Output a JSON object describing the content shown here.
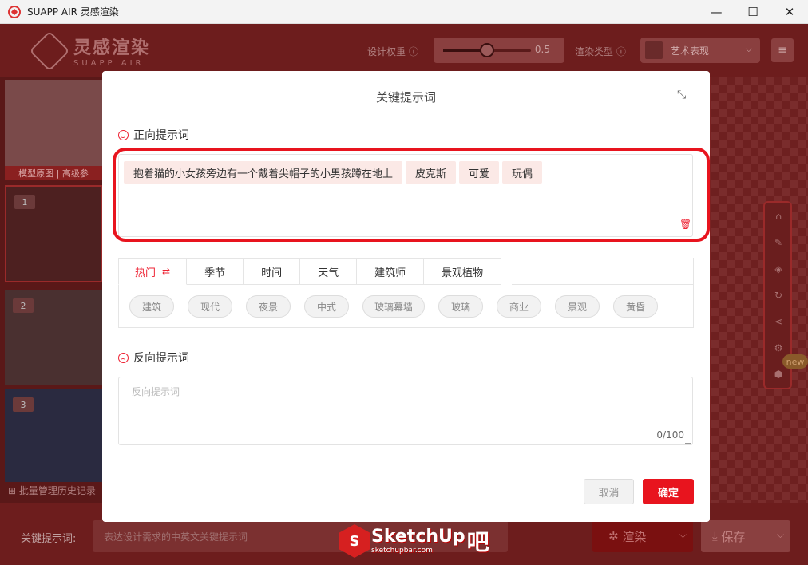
{
  "window": {
    "title": "SUAPP AIR 灵感渲染",
    "minimize_glyph": "—",
    "maximize_glyph": "☐",
    "close_glyph": "✕"
  },
  "header": {
    "logo_main": "灵感渲染",
    "logo_sub": "SUAPP AIR",
    "design_weight_label": "设计权重",
    "design_weight_value": "0.5",
    "design_weight_fraction": 0.5,
    "render_type_label": "渲染类型",
    "render_type_selected": "艺术表现",
    "help_icon": "question-circle-icon"
  },
  "left_panel": {
    "cards": [
      {
        "num": "",
        "caption": "模型原图 | 高级参"
      },
      {
        "num": "1"
      },
      {
        "num": "2"
      },
      {
        "num": "3"
      }
    ],
    "history_link": "批量管理历史记录"
  },
  "right_tools": {
    "icons": [
      "home-icon",
      "edit-icon",
      "layers-icon",
      "refresh-icon",
      "share-icon",
      "gear-icon",
      "cube-icon"
    ],
    "new_badge": "new"
  },
  "bottom": {
    "keyword_label": "关键提示词:",
    "keyword_placeholder": "表达设计需求的中英文关键提示词",
    "render_label": "渲染",
    "save_label": "保存"
  },
  "watermark": {
    "brand": "SketchUp",
    "domain": "sketchupbar.com",
    "ba": "吧"
  },
  "modal": {
    "title": "关键提示词",
    "positive_label": "正向提示词",
    "positive_tags": [
      "抱着猫的小女孩旁边有一个戴着尖帽子的小男孩蹲在地上",
      "皮克斯",
      "可爱",
      "玩偶"
    ],
    "tabs": [
      "热门",
      "季节",
      "时间",
      "天气",
      "建筑师",
      "景观植物"
    ],
    "active_tab": "热门",
    "chips": [
      "建筑",
      "现代",
      "夜景",
      "中式",
      "玻璃幕墙",
      "玻璃",
      "商业",
      "景观",
      "黄昏"
    ],
    "negative_label": "反向提示词",
    "negative_placeholder": "反向提示词",
    "negative_counter": "0/100",
    "cancel_label": "取消",
    "ok_label": "确定"
  },
  "colors": {
    "accent": "#e8141e",
    "tag_bg": "#fbe9e6",
    "overlay_header": "#6d1d1d"
  }
}
